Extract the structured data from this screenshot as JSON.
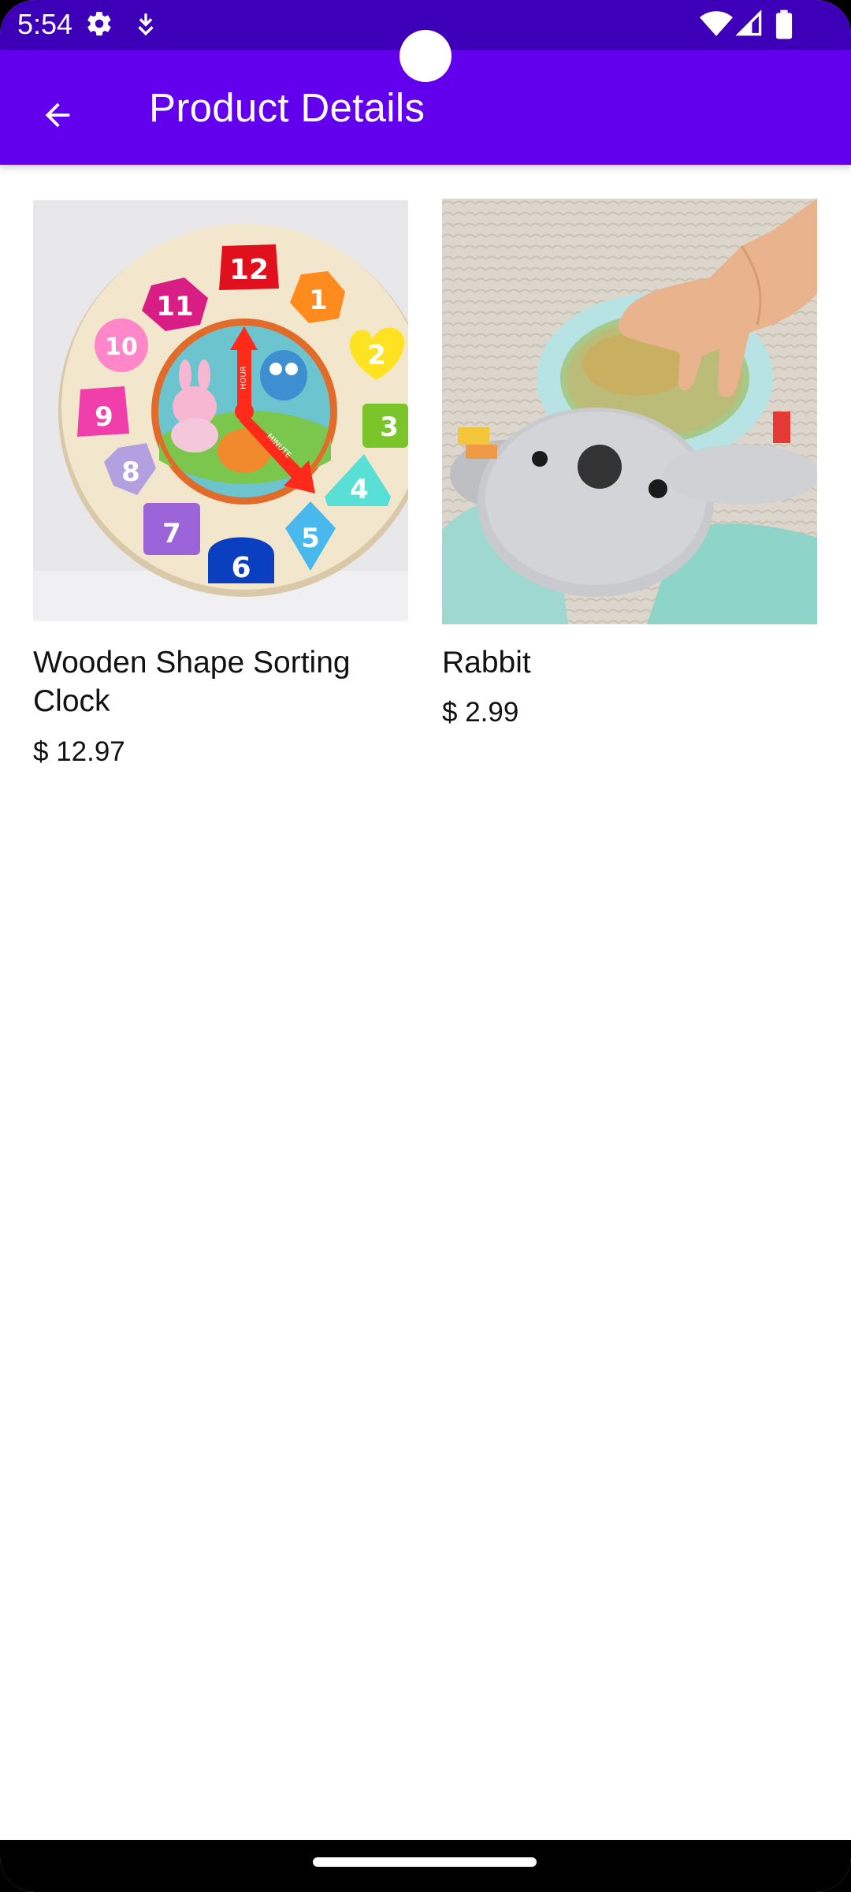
{
  "status_bar": {
    "time": "5:54",
    "left_icons": [
      "gear-icon",
      "download-icon"
    ],
    "right_icons": [
      "wifi-icon",
      "signal-icon",
      "battery-icon"
    ]
  },
  "app_bar": {
    "title": "Product Details",
    "back_icon": "arrow-left-icon"
  },
  "products": [
    {
      "name": "Wooden Shape Sorting Clock",
      "price": "$ 12.97"
    },
    {
      "name": "Rabbit",
      "price": "$ 2.99"
    }
  ],
  "clock_toy": {
    "numbers": [
      "12",
      "1",
      "2",
      "3",
      "4",
      "5",
      "6",
      "7",
      "8",
      "9",
      "10",
      "11"
    ],
    "hand_labels": [
      "HOUR",
      "MINUTE"
    ]
  },
  "colors": {
    "status_bar": "#3d00b8",
    "app_bar": "#6200ee",
    "background": "#ffffff",
    "text": "#111111"
  }
}
